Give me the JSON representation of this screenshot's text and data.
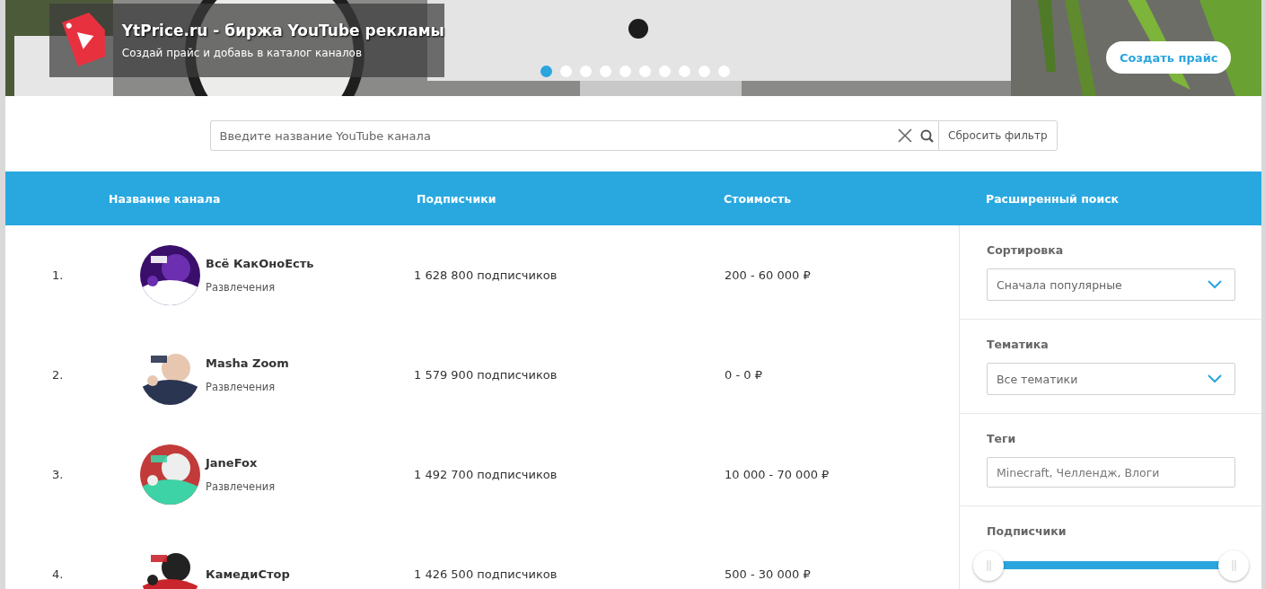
{
  "banner": {
    "title": "YtPrice.ru - биржа YouTube рекламы",
    "subtitle": "Создай прайс и добавь в каталог каналов",
    "slides": [
      {
        "selected": true
      },
      {
        "selected": false
      },
      {
        "selected": false
      },
      {
        "selected": false
      },
      {
        "selected": false
      },
      {
        "selected": false
      },
      {
        "selected": false
      },
      {
        "selected": false
      },
      {
        "selected": false
      },
      {
        "selected": false
      }
    ],
    "button": "Создать прайс"
  },
  "search": {
    "placeholder": "Введите название YouTube канала",
    "reset_button": "Сбросить фильтр"
  },
  "table": {
    "columns": [
      "Название канала",
      "Подписчики",
      "Стоимость"
    ],
    "rows": [
      {
        "rank": "1.",
        "name": "Всё КакОноЕсть",
        "category": "Развлечения",
        "subscribers": "1 628 800 подписчиков",
        "price": "200 - 60 000 ₽"
      },
      {
        "rank": "2.",
        "name": "Masha Zoom",
        "category": "Развлечения",
        "subscribers": "1 579 900 подписчиков",
        "price": "0 - 0 ₽"
      },
      {
        "rank": "3.",
        "name": "JaneFox",
        "category": "Развлечения",
        "subscribers": "1 492 700 подписчиков",
        "price": "10 000 - 70 000 ₽"
      },
      {
        "rank": "4.",
        "name": "КамедиСтор",
        "subscribers": "1 426 500 подписчиков",
        "price": "500 - 30 000 ₽"
      }
    ]
  },
  "filters": {
    "title": "Расширенный поиск",
    "sections": [
      {
        "kind": "select",
        "label": "Сортировка",
        "value": "Сначала популярные"
      },
      {
        "kind": "select",
        "label": "Тематика",
        "value": "Все тематики"
      },
      {
        "kind": "input",
        "label": "Теги",
        "placeholder": "Minecraft, Челлендж, Влоги"
      },
      {
        "kind": "range",
        "label": "Подписчики",
        "low": {
          "level": 0
        },
        "high": {
          "level": 1
        }
      }
    ]
  }
}
